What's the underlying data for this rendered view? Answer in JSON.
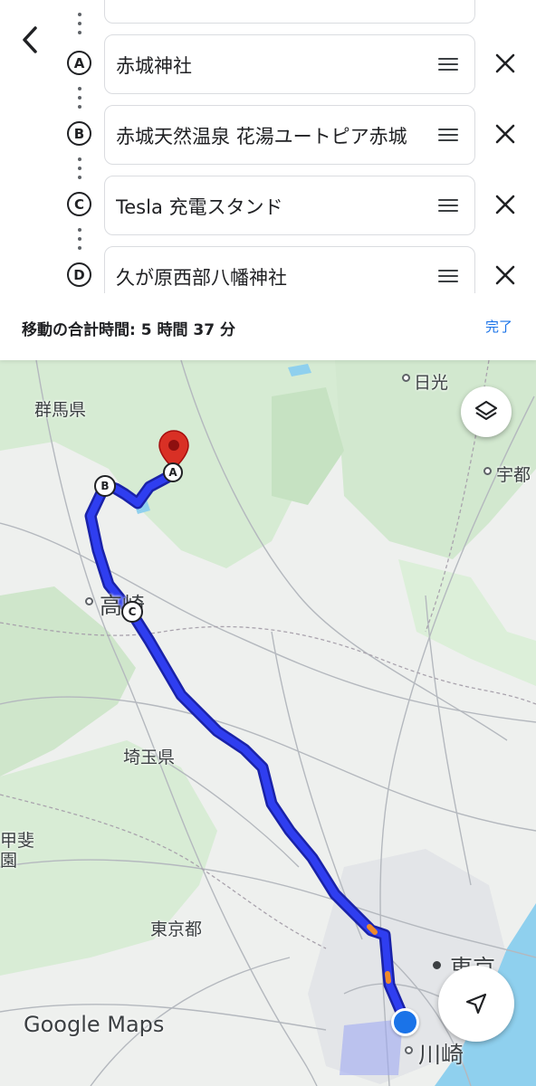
{
  "stops": [
    {
      "marker": "A",
      "name": "赤城神社"
    },
    {
      "marker": "B",
      "name": "赤城天然温泉 花湯ユートピア赤城"
    },
    {
      "marker": "C",
      "name": "Tesla 充電スタンド"
    },
    {
      "marker": "D",
      "name": "久が原西部八幡神社"
    }
  ],
  "summary": {
    "total_time": "移動の合計時間: 5 時間 37 分",
    "done_label": "完了"
  },
  "map": {
    "labels": {
      "gunma": "群馬県",
      "nikko": "日光",
      "utsunomiya": "宇都",
      "takasaki": "高崎",
      "saitama": "埼玉県",
      "yamanashi_a": "甲斐",
      "yamanashi_b": "園",
      "tokyo_pref": "東京都",
      "tokyo_city": "東京",
      "kawasaki": "川崎"
    },
    "pins": {
      "a": "A",
      "b": "B",
      "c": "C"
    },
    "logo": "Google Maps",
    "route_color": "#2f3ef0",
    "destination_pin_color": "#d93025"
  },
  "icons": {
    "back": "chevron-left-icon",
    "drag": "drag-handle-icon",
    "remove": "close-icon",
    "layers": "layers-icon",
    "navigate": "navigation-arrow-icon"
  }
}
